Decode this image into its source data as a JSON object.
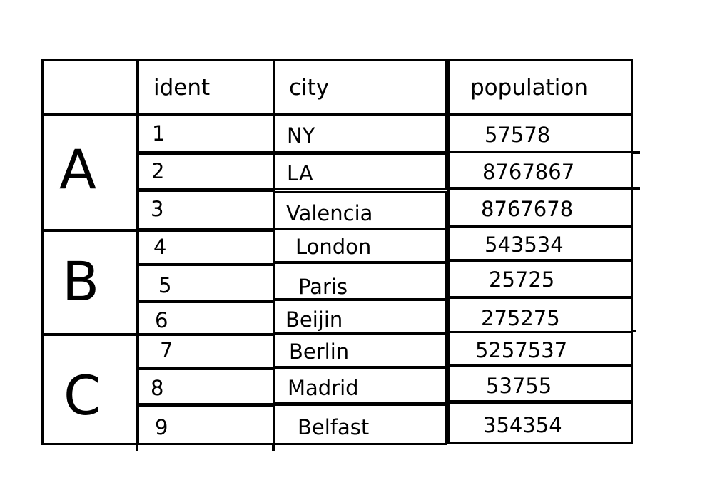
{
  "table": {
    "columns": [
      {
        "key": "group",
        "label": ""
      },
      {
        "key": "ident",
        "label": "ident"
      },
      {
        "key": "city",
        "label": "city"
      },
      {
        "key": "population",
        "label": "population"
      }
    ],
    "groups": [
      {
        "label": "A",
        "row_span": 3
      },
      {
        "label": "B",
        "row_span": 3
      },
      {
        "label": "C",
        "row_span": 3
      }
    ],
    "rows": [
      {
        "group": "A",
        "ident": "1",
        "city": "NY",
        "population": "57578"
      },
      {
        "group": "A",
        "ident": "2",
        "city": "LA",
        "population": "8767867"
      },
      {
        "group": "A",
        "ident": "3",
        "city": "Valencia",
        "population": "8767678"
      },
      {
        "group": "B",
        "ident": "4",
        "city": "London",
        "population": "543534"
      },
      {
        "group": "B",
        "ident": "5",
        "city": "Paris",
        "population": "25725"
      },
      {
        "group": "B",
        "ident": "6",
        "city": "Beijin",
        "population": "275275"
      },
      {
        "group": "C",
        "ident": "7",
        "city": "Berlin",
        "population": "5257537"
      },
      {
        "group": "C",
        "ident": "8",
        "city": "Madrid",
        "population": "53755"
      },
      {
        "group": "C",
        "ident": "9",
        "city": "Belfast",
        "population": "354354"
      }
    ],
    "colors": {
      "background": "#ffffff",
      "border": "#000000",
      "text": "#000000"
    }
  }
}
